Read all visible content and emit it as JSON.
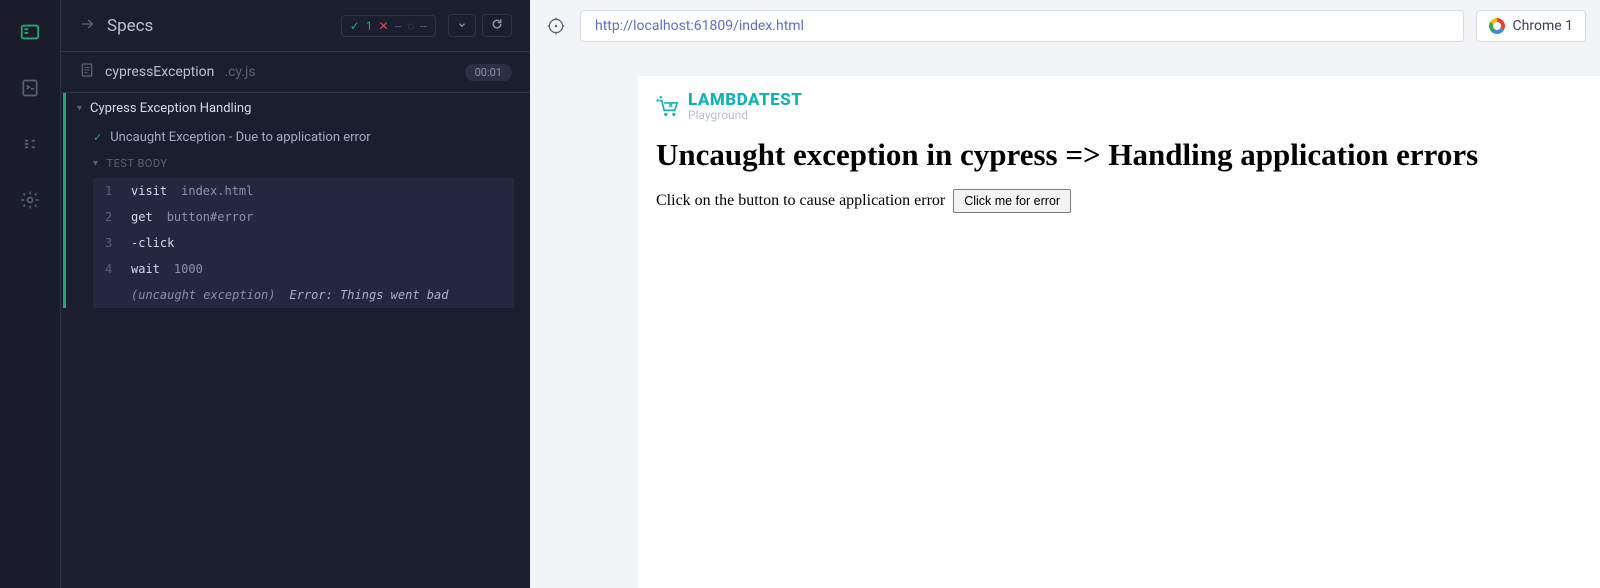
{
  "nav": {
    "specs_label": "Specs"
  },
  "stats": {
    "passed": "1",
    "failed": "--",
    "pending": "--"
  },
  "spec_file": {
    "name": "cypressException",
    "ext": ".cy.js",
    "duration": "00:01"
  },
  "suite": {
    "name": "Cypress Exception Handling"
  },
  "test": {
    "name": "Uncaught Exception - Due to application error",
    "body_label": "TEST BODY"
  },
  "commands": [
    {
      "num": "1",
      "name": "visit",
      "arg": "index.html"
    },
    {
      "num": "2",
      "name": "get",
      "arg": "button#error"
    },
    {
      "num": "3",
      "name": "-click",
      "arg": ""
    },
    {
      "num": "4",
      "name": "wait",
      "arg": "1000"
    }
  ],
  "exception": {
    "label": "(uncaught exception)",
    "message": "Error: Things went bad"
  },
  "url": "http://localhost:61809/index.html",
  "browser": {
    "label": "Chrome 1"
  },
  "app": {
    "logo_name": "LAMBDATEST",
    "logo_sub": "Playground",
    "heading": "Uncaught exception in cypress => Handling application errors",
    "subtext": "Click on the button to cause application error",
    "button_label": "Click me for error"
  }
}
